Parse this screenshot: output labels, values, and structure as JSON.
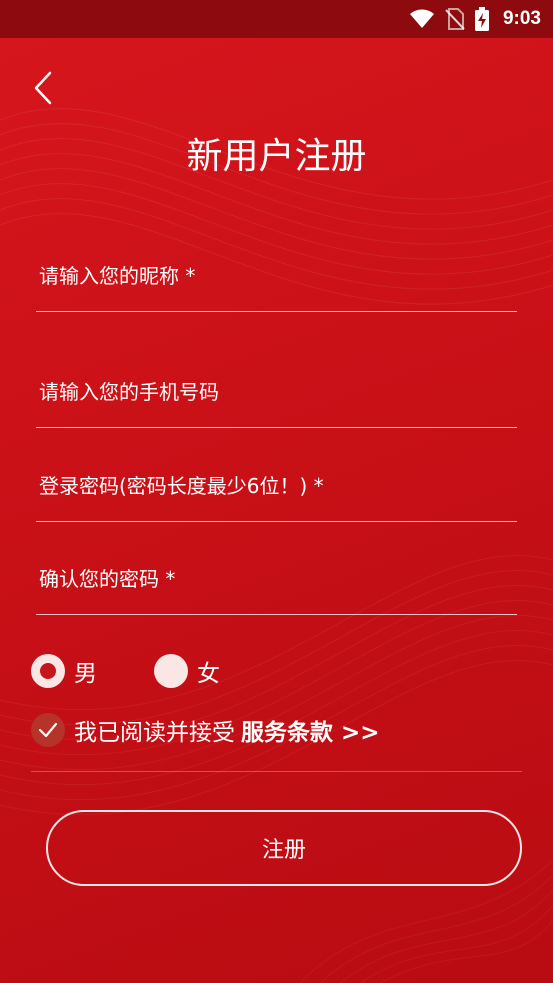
{
  "status_bar": {
    "time": "9:03",
    "icons": [
      "wifi-icon",
      "no-sim-icon",
      "battery-charging-icon"
    ]
  },
  "header": {
    "back_icon": "chevron-left-icon",
    "title": "新用户注册"
  },
  "form": {
    "nickname": {
      "value": "",
      "placeholder": "请输入您的昵称 *"
    },
    "phone": {
      "value": "",
      "placeholder": "请输入您的手机号码"
    },
    "password": {
      "value": "",
      "placeholder": "登录密码(密码长度最少6位！) *"
    },
    "confirm_password": {
      "value": "",
      "placeholder": "确认您的密码 *"
    }
  },
  "gender": {
    "options": [
      {
        "label": "男",
        "selected": true
      },
      {
        "label": "女",
        "selected": false
      }
    ]
  },
  "agreement": {
    "checked": true,
    "text": "我已阅读并接受",
    "link": "服务条款 >>"
  },
  "register_button": {
    "label": "注册"
  },
  "colors": {
    "background": "#c91018",
    "status_bar": "#8d0b0f",
    "radio_dot": "#c4161c",
    "check_fill": "#b53328"
  }
}
